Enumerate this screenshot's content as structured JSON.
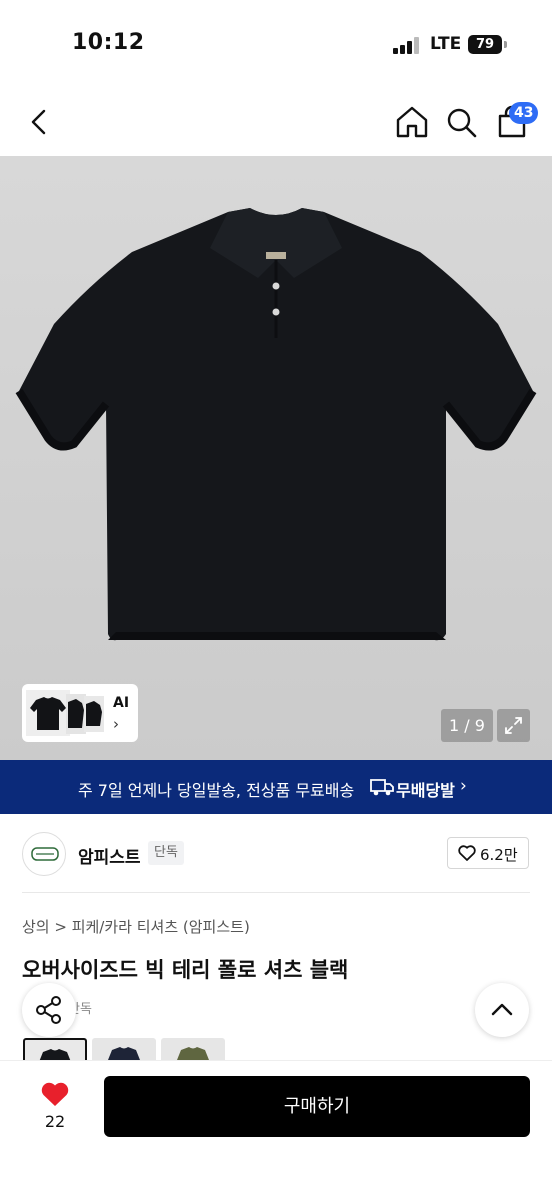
{
  "status_bar": {
    "time": "10:12",
    "network": "LTE",
    "battery": "79"
  },
  "header": {
    "cart_badge": "43"
  },
  "gallery": {
    "ai_label": "AI",
    "ai_chevron": "›",
    "page_counter": "1 / 9"
  },
  "shipping_banner": {
    "text": "주 7일 언제나 당일발송, 전상품 무료배송",
    "brand": "무배당발",
    "chevron": "›",
    "color": "#0b2a7a"
  },
  "shop": {
    "name": "암피스트",
    "badge": "단독",
    "like_count": "6.2만"
  },
  "product": {
    "breadcrumb": "상의 > 피케/카라 티셔츠 (암피스트)",
    "title": "오버사이즈드 빅 테리 폴로 셔츠 블랙",
    "tag": "단독",
    "color": "블랙"
  },
  "bottom_bar": {
    "wish_count": "22",
    "buy_label": "구매하기",
    "heart_color": "#e8202c"
  },
  "icons": [
    "chevron-left-icon",
    "home-icon",
    "search-icon",
    "cart-icon",
    "expand-icon",
    "truck-icon",
    "heart-icon",
    "share-icon",
    "chevron-up-icon"
  ]
}
